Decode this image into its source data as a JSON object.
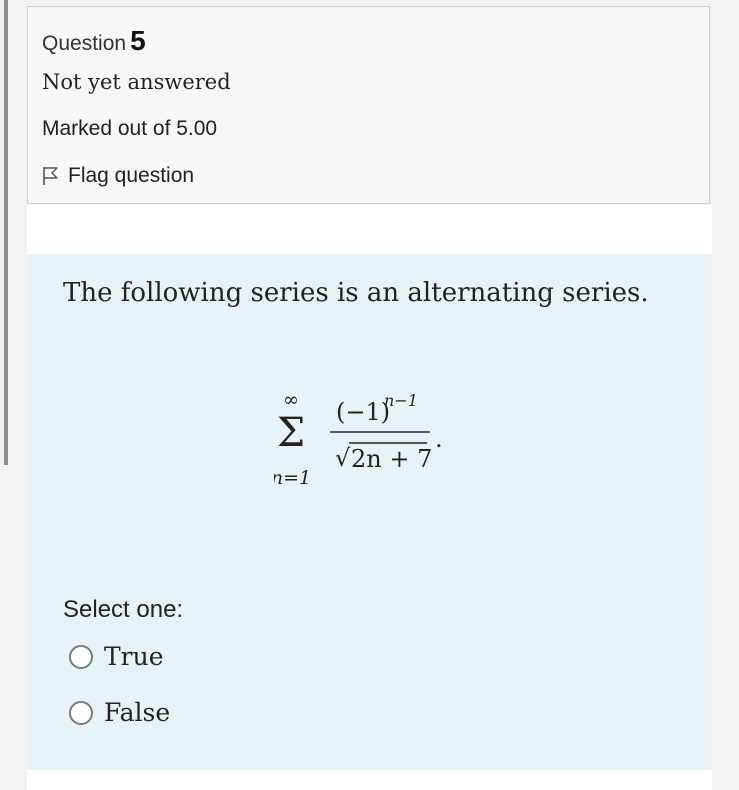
{
  "question": {
    "label": "Question",
    "number": "5",
    "state": "Not yet answered",
    "grade": "Marked out of 5.00",
    "flag_label": "Flag question",
    "flag_icon": "flag-outline-icon"
  },
  "content": {
    "prompt": "The following series is an alternating series.",
    "formula": {
      "sum_upper": "∞",
      "sum_symbol": "Σ",
      "sum_lower": "n=1",
      "numerator_base": "(−1)",
      "numerator_exponent": "n−1",
      "radical_sign": "√",
      "denominator": "2n + 7",
      "trailing": "."
    },
    "select_label": "Select one:",
    "options": [
      {
        "label": "True",
        "selected": false
      },
      {
        "label": "False",
        "selected": false
      }
    ]
  },
  "colors": {
    "page_background": "#f2f2f2",
    "info_background": "#f7f7f7",
    "content_background": "#e6f2f5"
  }
}
